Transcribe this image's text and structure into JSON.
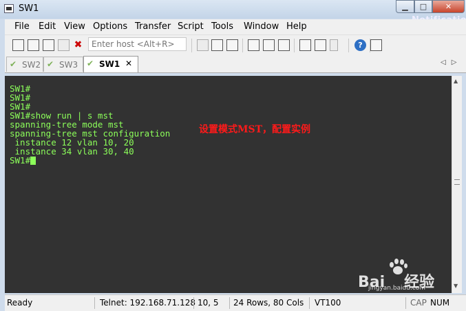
{
  "window": {
    "title": "SW1",
    "notification": "Notification"
  },
  "menu": [
    "File",
    "Edit",
    "View",
    "Options",
    "Transfer",
    "Script",
    "Tools",
    "Window",
    "Help"
  ],
  "toolbar": {
    "host_placeholder": "Enter host <Alt+R>"
  },
  "tabs": [
    {
      "label": "SW2",
      "active": false
    },
    {
      "label": "SW3",
      "active": false
    },
    {
      "label": "SW1",
      "active": true
    }
  ],
  "terminal": {
    "lines": [
      "SW1#",
      "SW1#",
      "SW1#",
      "SW1#show run | s mst",
      "spanning-tree mode mst",
      "spanning-tree mst configuration",
      " instance 12 vlan 10, 20",
      " instance 34 vlan 30, 40"
    ],
    "prompt": "SW1#",
    "annotation": "设置模式MST，配置实例",
    "text_color": "#8cff5a",
    "background": "#323232"
  },
  "watermark": {
    "brand": "Bai",
    "brand_tail": "经验",
    "sub": "jingyan.baidu.com"
  },
  "status": {
    "state": "Ready",
    "connection": "Telnet: 192.168.71.128",
    "cursor_pos": "10,   5",
    "size": "24 Rows, 80 Cols",
    "emulation": "VT100",
    "caps": "CAP",
    "num": "NUM"
  }
}
